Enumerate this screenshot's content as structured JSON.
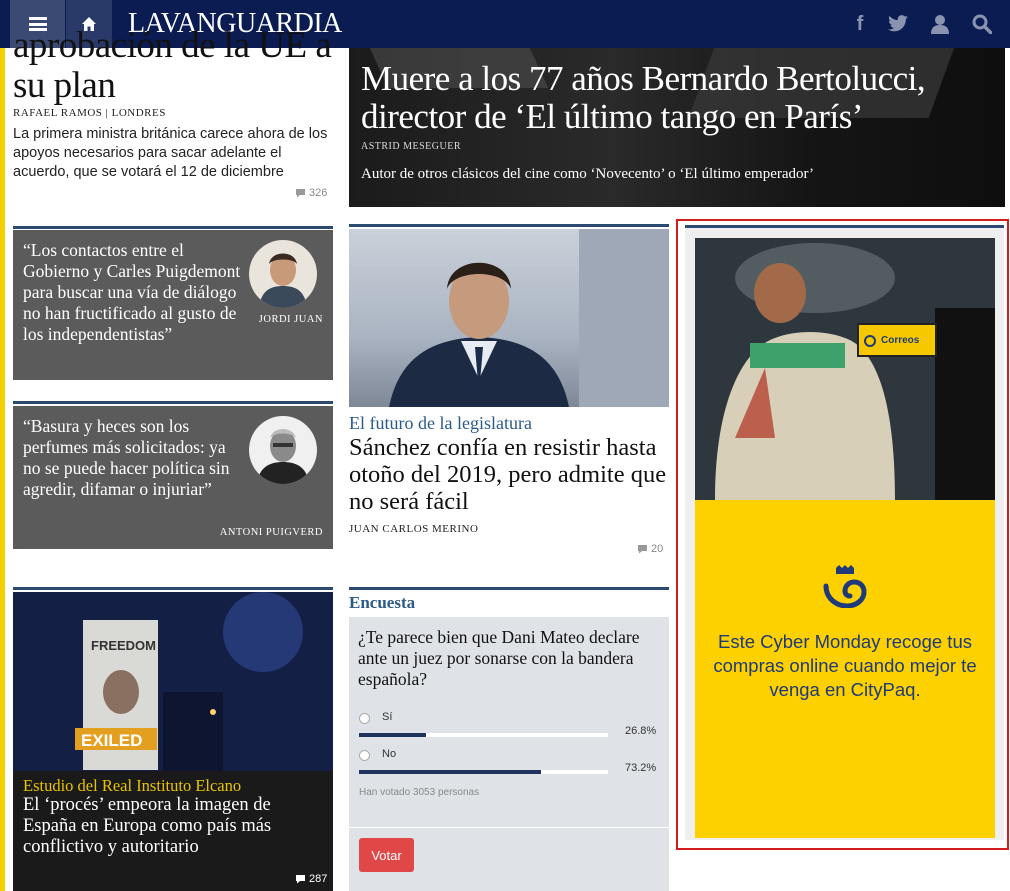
{
  "header": {
    "logo": "LAVANGUARDIA"
  },
  "lead": {
    "title": "aprobación de la UE a su plan",
    "byline": "RAFAEL RAMOS | LONDRES",
    "summary": "La primera ministra británica carece ahora de los apoyos necesarios para sacar adelante el acuerdo, que se votará el 12 de diciembre",
    "comments": "326"
  },
  "hero": {
    "title": "Muere a los 77 años Bernardo Bertolucci, director de ‘El último tango en París’",
    "byline": "ASTRID MESEGUER",
    "summary": "Autor de otros clásicos del cine como ‘Novecento’ o ‘El último emperador’"
  },
  "opinions": [
    {
      "quote": "“Los contactos entre el Gobierno y Carles Puigdemont para buscar una vía de diálogo no han fructificado al gusto de los independentistas”",
      "author": "JORDI JUAN"
    },
    {
      "quote": "“Basura y heces son los perfumes más solicitados: ya no se puede hacer política sin agredir, difamar o injuriar”",
      "author": "ANTONI PUIGVERD"
    }
  ],
  "middle": {
    "kicker": "El futuro de la legislatura",
    "title": "Sánchez confía en resistir hasta otoño del 2019, pero admite que no será fácil",
    "byline": "JUAN CARLOS MERINO",
    "comments": "20"
  },
  "bottom_left": {
    "sign_text": "FREEDOM",
    "exiled_text": "EXILED",
    "kicker": "Estudio del Real Instituto Elcano",
    "title": "El ‘procés’ empeora la imagen de España en Europa como país más conflictivo y autoritario",
    "comments": "287"
  },
  "poll": {
    "label": "Encuesta",
    "question": "¿Te parece bien que Dani Mateo declare ante un juez por sonarse con la bandera española?",
    "options": [
      {
        "label": "Sí",
        "percent_text": "26.8%",
        "percent": 26.8
      },
      {
        "label": "No",
        "percent_text": "73.2%",
        "percent": 73.2
      }
    ],
    "votes": "Han votado 3053 personas",
    "button": "Votar"
  },
  "ad": {
    "sign": "Correos",
    "text": "Este Cyber Monday recoge tus compras online cuando mejor te venga en CityPaq.",
    "accent": "#fdd000",
    "brand": "#1f3a7a"
  },
  "colors": {
    "navbar": "#0a1c52",
    "section_rule": "#2a4a72",
    "kicker": "#2a5a8a",
    "vote_button": "#e04848"
  }
}
